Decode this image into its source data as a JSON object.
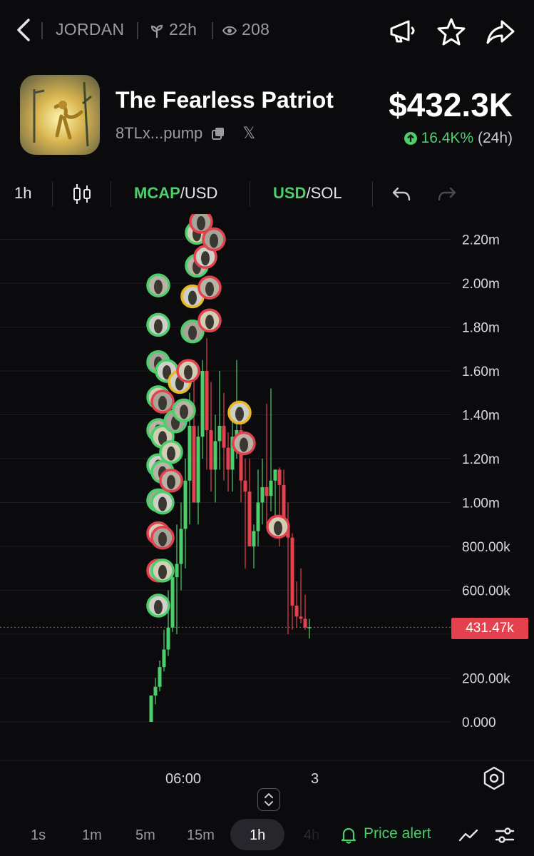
{
  "header": {
    "ticker": "JORDAN",
    "age": "22h",
    "watchers": "208"
  },
  "token": {
    "name": "The Fearless Patriot",
    "address": "8TLx...pump",
    "social": "𝕏",
    "price": "$432.3K",
    "change": "16.4K%",
    "change_period": "(24h)"
  },
  "toolbar": {
    "interval": "1h",
    "metric_active": "MCAP",
    "metric_rest": "/USD",
    "currency_active": "USD",
    "currency_rest": "/SOL"
  },
  "colors": {
    "up": "#4ccf6b",
    "down": "#e3414e",
    "background": "#0b0b0e"
  },
  "chart_data": {
    "type": "candlestick",
    "y_unit": "MCAP (USD)",
    "y_ticks": [
      "0.000",
      "200.00k",
      "400.00k",
      "600.00k",
      "800.00k",
      "1.00m",
      "1.20m",
      "1.40m",
      "1.60m",
      "1.80m",
      "2.00m",
      "2.20m"
    ],
    "y_tick_values": [
      0,
      200000,
      400000,
      600000,
      800000,
      1000000,
      1200000,
      1400000,
      1600000,
      1800000,
      2000000,
      2200000
    ],
    "ylim": [
      0,
      2200000
    ],
    "x_labels": [
      "06:00",
      "3"
    ],
    "current_value": 431470,
    "current_label": "431.47k",
    "candles": [
      {
        "o": 0,
        "h": 120000,
        "l": 0,
        "c": 120000
      },
      {
        "o": 120000,
        "h": 200000,
        "l": 80000,
        "c": 160000
      },
      {
        "o": 160000,
        "h": 280000,
        "l": 140000,
        "c": 250000
      },
      {
        "o": 250000,
        "h": 420000,
        "l": 230000,
        "c": 330000
      },
      {
        "o": 330000,
        "h": 600000,
        "l": 300000,
        "c": 430000
      },
      {
        "o": 430000,
        "h": 720000,
        "l": 410000,
        "c": 660000
      },
      {
        "o": 660000,
        "h": 900000,
        "l": 400000,
        "c": 720000
      },
      {
        "o": 720000,
        "h": 1000000,
        "l": 600000,
        "c": 880000
      },
      {
        "o": 880000,
        "h": 1200000,
        "l": 700000,
        "c": 1100000
      },
      {
        "o": 1100000,
        "h": 1500000,
        "l": 900000,
        "c": 1350000
      },
      {
        "o": 1350000,
        "h": 1650000,
        "l": 1050000,
        "c": 1000000
      },
      {
        "o": 1000000,
        "h": 1350000,
        "l": 900000,
        "c": 1300000
      },
      {
        "o": 1300000,
        "h": 1650000,
        "l": 1200000,
        "c": 1600000
      },
      {
        "o": 1600000,
        "h": 1750000,
        "l": 1150000,
        "c": 1330000
      },
      {
        "o": 1330000,
        "h": 1550000,
        "l": 1050000,
        "c": 1150000
      },
      {
        "o": 1150000,
        "h": 1400000,
        "l": 1000000,
        "c": 1280000
      },
      {
        "o": 1280000,
        "h": 1600000,
        "l": 1150000,
        "c": 1350000
      },
      {
        "o": 1350000,
        "h": 1500000,
        "l": 1100000,
        "c": 1250000
      },
      {
        "o": 1250000,
        "h": 1320000,
        "l": 1050000,
        "c": 1150000
      },
      {
        "o": 1150000,
        "h": 1400000,
        "l": 1050000,
        "c": 1300000
      },
      {
        "o": 1300000,
        "h": 1650000,
        "l": 1200000,
        "c": 1330000
      },
      {
        "o": 1330000,
        "h": 1400000,
        "l": 1000000,
        "c": 1100000
      },
      {
        "o": 1100000,
        "h": 1200000,
        "l": 700000,
        "c": 1050000
      },
      {
        "o": 1050000,
        "h": 1200000,
        "l": 800000,
        "c": 800000
      },
      {
        "o": 800000,
        "h": 900000,
        "l": 700000,
        "c": 870000
      },
      {
        "o": 870000,
        "h": 1150000,
        "l": 800000,
        "c": 1000000
      },
      {
        "o": 1000000,
        "h": 1200000,
        "l": 900000,
        "c": 1070000
      },
      {
        "o": 1070000,
        "h": 1450000,
        "l": 900000,
        "c": 1030000
      },
      {
        "o": 1030000,
        "h": 1520000,
        "l": 960000,
        "c": 1100000
      },
      {
        "o": 1100000,
        "h": 1150000,
        "l": 860000,
        "c": 1150000
      },
      {
        "o": 1150000,
        "h": 1160000,
        "l": 800000,
        "c": 1080000
      },
      {
        "o": 1080000,
        "h": 1150000,
        "l": 850000,
        "c": 880000
      },
      {
        "o": 880000,
        "h": 1000000,
        "l": 400000,
        "c": 840000
      },
      {
        "o": 840000,
        "h": 860000,
        "l": 420000,
        "c": 530000
      },
      {
        "o": 530000,
        "h": 640000,
        "l": 430000,
        "c": 480000
      },
      {
        "o": 480000,
        "h": 700000,
        "l": 450000,
        "c": 470000
      },
      {
        "o": 470000,
        "h": 580000,
        "l": 420000,
        "c": 430000
      },
      {
        "o": 430000,
        "h": 470000,
        "l": 380000,
        "c": 431470
      }
    ],
    "trade_markers": [
      {
        "c": 0,
        "v": 530000,
        "s": "buy"
      },
      {
        "c": 0,
        "v": 690000,
        "s": "sell"
      },
      {
        "c": 0,
        "v": 860000,
        "s": "sell"
      },
      {
        "c": 0,
        "v": 1010000,
        "s": "buy"
      },
      {
        "c": 0,
        "v": 1170000,
        "s": "buy"
      },
      {
        "c": 0,
        "v": 1330000,
        "s": "buy"
      },
      {
        "c": 0,
        "v": 1480000,
        "s": "buy"
      },
      {
        "c": 0,
        "v": 1640000,
        "s": "buy"
      },
      {
        "c": 0,
        "v": 1810000,
        "s": "buy"
      },
      {
        "c": 0,
        "v": 1990000,
        "s": "buy"
      },
      {
        "c": 1,
        "v": 690000,
        "s": "buy"
      },
      {
        "c": 1,
        "v": 840000,
        "s": "sell"
      },
      {
        "c": 1,
        "v": 1000000,
        "s": "buy"
      },
      {
        "c": 1,
        "v": 1140000,
        "s": "buy"
      },
      {
        "c": 1,
        "v": 1300000,
        "s": "buy"
      },
      {
        "c": 1,
        "v": 1460000,
        "s": "sell"
      },
      {
        "c": 2,
        "v": 1600000,
        "s": "buy"
      },
      {
        "c": 3,
        "v": 1100000,
        "s": "sell"
      },
      {
        "c": 3,
        "v": 1230000,
        "s": "buy"
      },
      {
        "c": 4,
        "v": 1370000,
        "s": "buy"
      },
      {
        "c": 5,
        "v": 1550000,
        "s": "yellow"
      },
      {
        "c": 6,
        "v": 1420000,
        "s": "buy"
      },
      {
        "c": 7,
        "v": 1600000,
        "s": "sell"
      },
      {
        "c": 8,
        "v": 1780000,
        "s": "buy"
      },
      {
        "c": 8,
        "v": 1940000,
        "s": "yellow"
      },
      {
        "c": 9,
        "v": 2080000,
        "s": "buy"
      },
      {
        "c": 9,
        "v": 2230000,
        "s": "buy"
      },
      {
        "c": 10,
        "v": 2280000,
        "s": "sell"
      },
      {
        "c": 11,
        "v": 2120000,
        "s": "sell"
      },
      {
        "c": 12,
        "v": 1980000,
        "s": "sell"
      },
      {
        "c": 12,
        "v": 1830000,
        "s": "sell"
      },
      {
        "c": 13,
        "v": 2200000,
        "s": "sell"
      },
      {
        "c": 19,
        "v": 1410000,
        "s": "yellow"
      },
      {
        "c": 20,
        "v": 1270000,
        "s": "sell"
      },
      {
        "c": 28,
        "v": 890000,
        "s": "sell"
      }
    ]
  },
  "bottom": {
    "timeframes": [
      "1s",
      "1m",
      "5m",
      "15m",
      "1h",
      "4h"
    ],
    "active_timeframe": "1h",
    "alert_label": "Price alert"
  }
}
